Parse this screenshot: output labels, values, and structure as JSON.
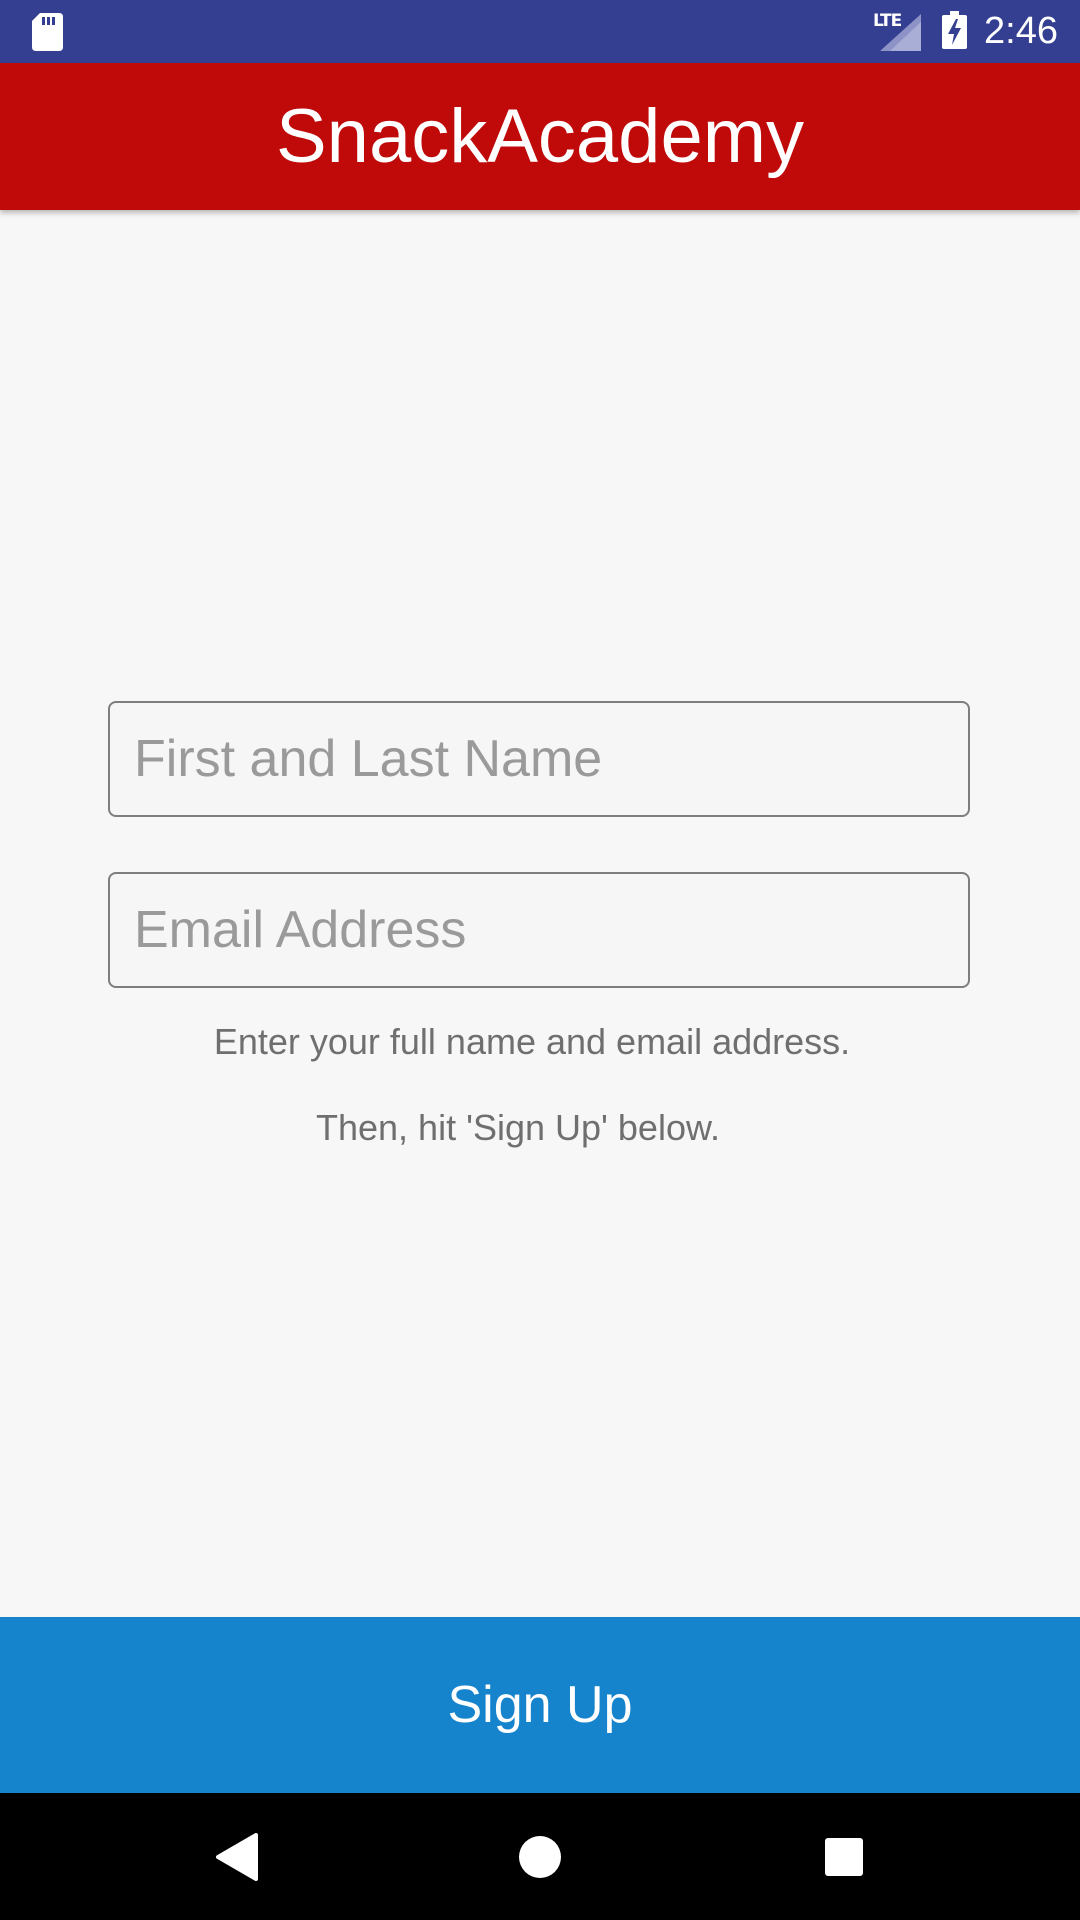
{
  "status_bar": {
    "network_label": "LTE",
    "time": "2:46",
    "background_color": "#343f92",
    "icons": [
      "sd-card-icon",
      "signal-icon",
      "battery-charging-icon"
    ]
  },
  "app_bar": {
    "title": "SnackAcademy",
    "background_color": "#c00a0a"
  },
  "form": {
    "name_field": {
      "value": "",
      "placeholder": "First and Last Name"
    },
    "email_field": {
      "value": "",
      "placeholder": "Email Address"
    },
    "hint_line_1": "Enter your full name and email address.",
    "hint_line_2": "Then, hit 'Sign Up' below."
  },
  "signup_button": {
    "label": "Sign Up",
    "background_color": "#1584cd"
  },
  "nav_bar": {
    "icons": [
      "back-icon",
      "home-icon",
      "recents-icon"
    ]
  }
}
